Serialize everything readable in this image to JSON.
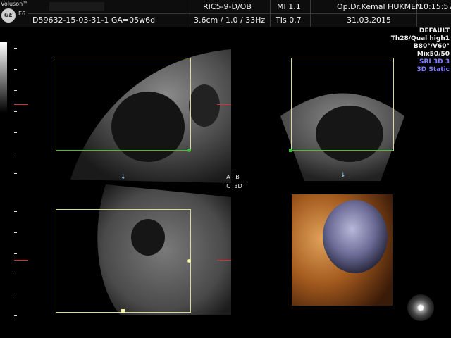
{
  "header": {
    "brand": "Voluson™",
    "logo": "GE",
    "model": "E6",
    "patient_id": "D59632-15-03-31-1 GA=05w6d",
    "probe": "RIC5-9-D/OB",
    "depth_info": "3.6cm / 1.0 / 33Hz",
    "mi": "MI  1.1",
    "tis": "TIs  0.7",
    "doctor": "Op.Dr.Kemal HUKMEN",
    "date": "31.03.2015",
    "time": "10:15:57"
  },
  "side_info": [
    {
      "text": "DEFAULT",
      "color": "#f2f2f2"
    },
    {
      "text": "Th28/Qual high1",
      "color": "#f2f2f2"
    },
    {
      "text": "B80°/V60°",
      "color": "#f2f2f2"
    },
    {
      "text": "Mix50/50",
      "color": "#f2f2f2"
    },
    {
      "text": "SRI 3D 3",
      "color": "#7f7fff"
    },
    {
      "text": "3D Static",
      "color": "#7f7fff"
    }
  ],
  "quadrant_labels": {
    "a": "A",
    "b": "B",
    "c": "C",
    "d": "3D"
  },
  "colors": {
    "roi": "#d8d8a0",
    "green_line": "#3fbf3f",
    "marker_red": "#c33",
    "marker_blue": "#8fd0ff"
  }
}
